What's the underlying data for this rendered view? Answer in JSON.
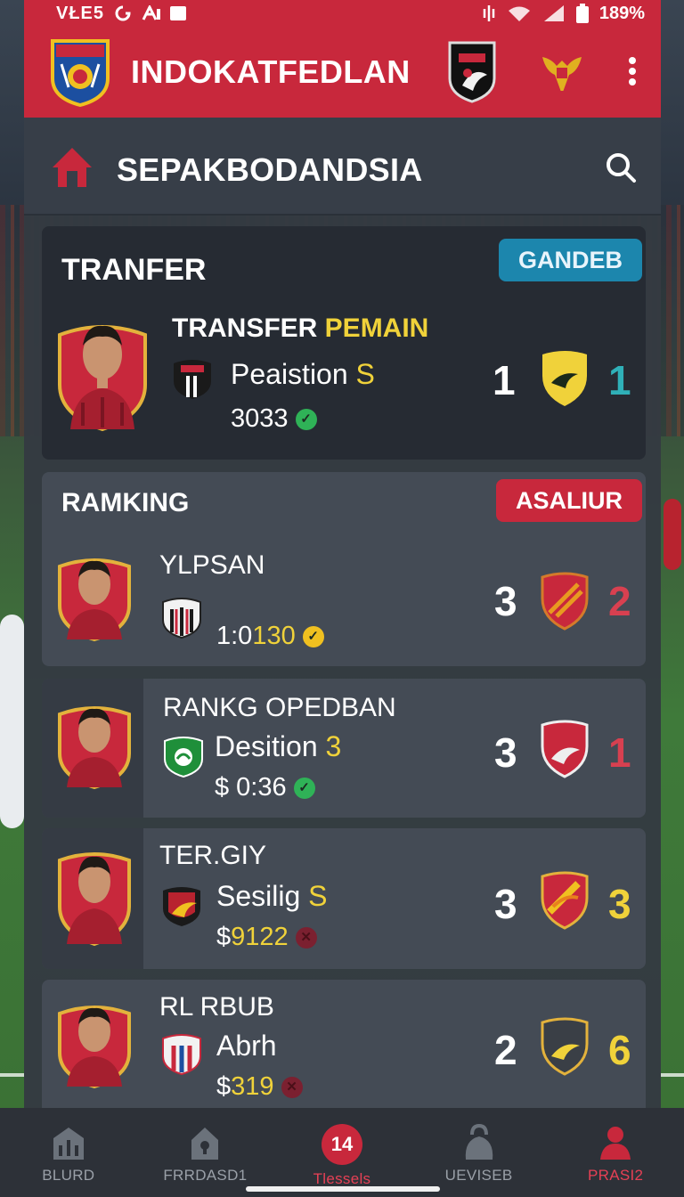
{
  "status_bar": {
    "left_text": "VŁE5",
    "right_text": "189%"
  },
  "header": {
    "title": "INDOKATFEDLAN"
  },
  "subheader": {
    "title": "SEPAKBODANDSIA"
  },
  "featured": {
    "section_title": "TRANFER",
    "tag": "GANDEB",
    "name_part1": "TRANSFER ",
    "name_part2": "PEMAIN",
    "position_label": "Peaistion ",
    "position_suffix": "S",
    "fee": "3033",
    "score_a": "1",
    "score_b": "1"
  },
  "ranking": {
    "section_title": "RAMKING",
    "tag": "ASALIUR",
    "rows": [
      {
        "name": "YLPSAN",
        "position_label": "",
        "position_suffix": "",
        "fee_prefix": "1:0",
        "fee_value": "130",
        "score_a": "3",
        "score_b": "2"
      },
      {
        "name": "RANKG OPEDBAN",
        "position_label": "Desition ",
        "position_suffix": "3",
        "fee_prefix": "$ ",
        "fee_value": "0:36",
        "score_a": "3",
        "score_b": "1"
      },
      {
        "name": "TER.GIY",
        "position_label": "Sesilig ",
        "position_suffix": "S",
        "fee_prefix": "$ ",
        "fee_value": "9122",
        "score_a": "3",
        "score_b": "3"
      },
      {
        "name": "RL RBUB",
        "position_label": "Abrh",
        "position_suffix": "",
        "fee_prefix": "$ ",
        "fee_value": "319",
        "score_a": "2",
        "score_b": "6"
      }
    ]
  },
  "bottom_nav": [
    {
      "label": "BLURD",
      "icon": "stadium-icon"
    },
    {
      "label": "FRRDASD1",
      "icon": "lock-icon"
    },
    {
      "label": "Tlessels",
      "icon": "notification-badge",
      "badge": "14"
    },
    {
      "label": "UEVISEB",
      "icon": "kettlebell-icon"
    },
    {
      "label": "PRASI2",
      "icon": "profile-icon"
    }
  ],
  "colors": {
    "brand_red": "#c8283c",
    "accent_yellow": "#f0d23a",
    "accent_teal": "#2fb0b8",
    "tag_blue": "#1c86ad",
    "panel": "#343a42"
  }
}
